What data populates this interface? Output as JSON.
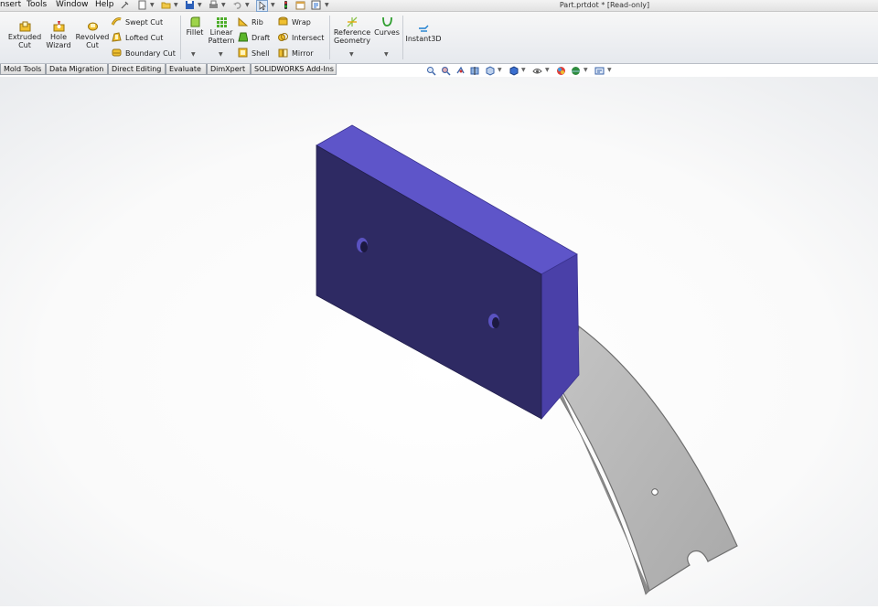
{
  "menu": {
    "items": [
      "nsert",
      "Tools",
      "Window",
      "Help"
    ]
  },
  "quick_access_icons": [
    "pin-icon",
    "new-document-icon",
    "open-folder-icon",
    "save-icon",
    "print-icon",
    "undo-icon",
    "select-arrow-icon",
    "rebuild-icon",
    "file-properties-icon",
    "options-icon"
  ],
  "document_title": "Part.prtdot * [Read-only]",
  "ribbon": {
    "extruded_cut": "Extruded\nCut",
    "hole_wizard": "Hole\nWizard",
    "revolved_cut": "Revolved\nCut",
    "swept_cut": "Swept Cut",
    "lofted_cut": "Lofted Cut",
    "boundary_cut": "Boundary Cut",
    "fillet": "Fillet",
    "linear_pattern": "Linear\nPattern",
    "rib": "Rib",
    "draft": "Draft",
    "shell": "Shell",
    "wrap": "Wrap",
    "intersect": "Intersect",
    "mirror": "Mirror",
    "reference_geometry": "Reference\nGeometry",
    "curves": "Curves",
    "instant3d": "Instant3D"
  },
  "tabs": [
    "Mold Tools",
    "Data Migration",
    "Direct Editing",
    "Evaluate",
    "DimXpert",
    "SOLIDWORKS Add-Ins"
  ],
  "view_toolbar_icons": [
    "zoom-to-fit-icon",
    "zoom-to-area-icon",
    "previous-view-icon",
    "section-view-icon",
    "view-orientation-icon",
    "display-style-icon",
    "hide-show-items-icon",
    "edit-appearance-icon",
    "apply-scene-icon",
    "view-settings-icon"
  ],
  "colors": {
    "block_front": "#2e2a63",
    "block_top": "#5e55c9",
    "block_side": "#4a40a8",
    "plate": "#b5b5b5",
    "viewport_bg": "#ffffff"
  }
}
